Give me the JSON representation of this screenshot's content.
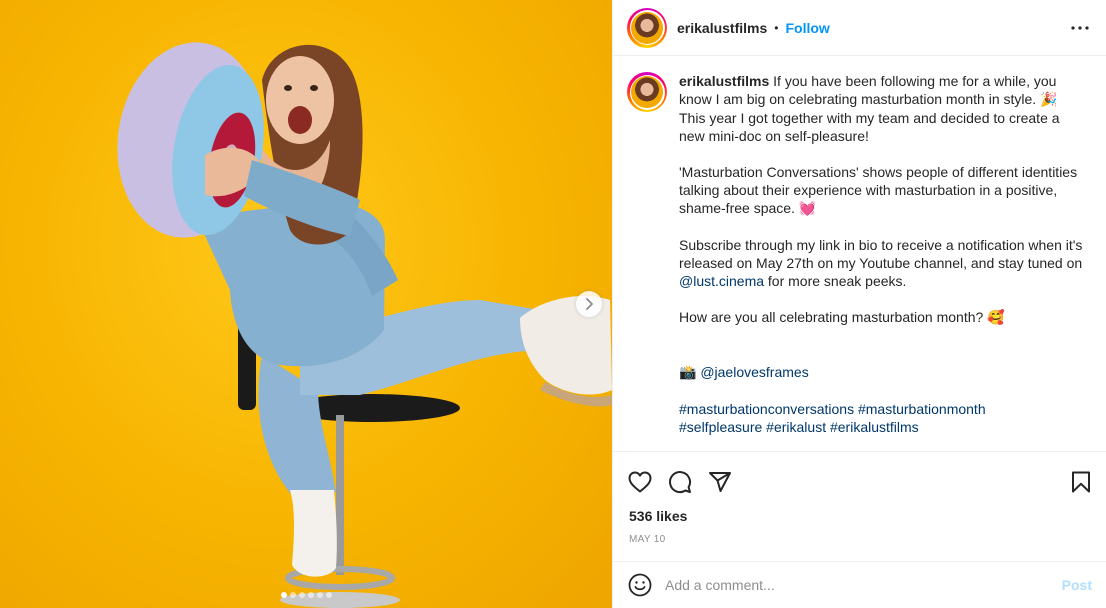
{
  "post": {
    "username": "erikalustfilms",
    "separator": "•",
    "follow_label": "Follow",
    "caption": {
      "username": "erikalustfilms",
      "para1_text": " If you have been following me for a while, you know I am big on celebrating masturbation month in style. ",
      "para1_emoji": "🎉",
      "para1_rest": " This year I got together with my team and decided to create a new mini-doc on self-pleasure!",
      "para2_text": "'Masturbation Conversations' shows people of different identities talking about their experience with masturbation in a positive, shame-free space. ",
      "para2_emoji": "💓",
      "para3_before": "Subscribe through my link in bio to receive a notification when it's released on May 27th on my Youtube channel, and stay tuned on ",
      "para3_mention": "@lust.cinema",
      "para3_after": " for more sneak peeks.",
      "para4_text": "How are you all celebrating masturbation month? ",
      "para4_emoji": "🥰",
      "credit_emoji": "📸",
      "credit_mention": "@jaelovesframes",
      "hashtags_line1": "#masturbationconversations #masturbationmonth",
      "hashtags_line2": "#selfpleasure #erikalust #erikalustfilms"
    },
    "likes": "536 likes",
    "date": "MAY 10",
    "comment": {
      "placeholder": "Add a comment...",
      "post_label": "Post"
    },
    "carousel": {
      "total_slides": 6,
      "active_slide": 1
    },
    "icons": {
      "more": "more-options-icon",
      "like": "heart-icon",
      "comment": "comment-icon",
      "share": "share-icon",
      "save": "bookmark-icon",
      "emoji": "smiley-icon",
      "next": "chevron-right-icon"
    },
    "colors": {
      "background_yellow": "#f7b400",
      "follow_blue": "#0095f6",
      "link_blue": "#00376b"
    }
  }
}
